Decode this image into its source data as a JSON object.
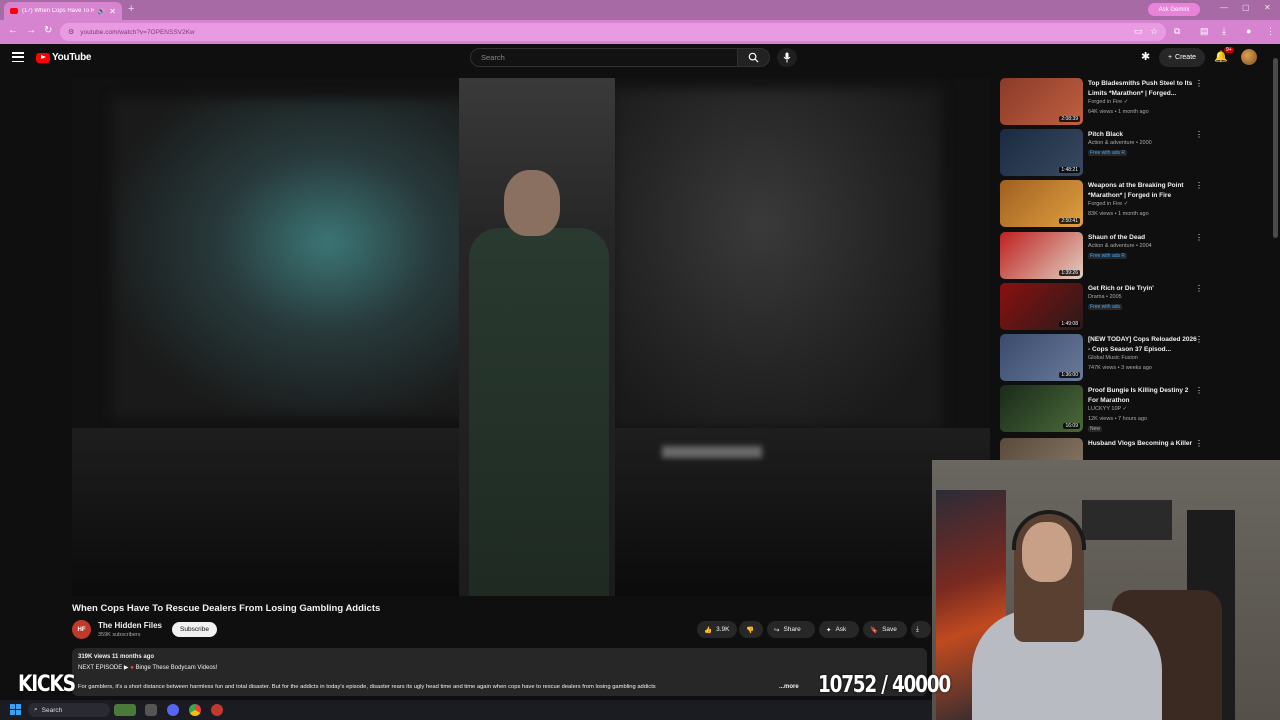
{
  "browser": {
    "tab_title": "(17) When Cops Have To R",
    "new_tab_symbol": "+",
    "ask_gemini": "Ask Gemini",
    "url": "youtube.com/watch?v=7OPENSSV2Kw"
  },
  "youtube": {
    "logo_text": "YouTube",
    "search_placeholder": "Search",
    "create_label": "Create",
    "notif_count": "9+"
  },
  "video": {
    "title": "When Cops Have To Rescue Dealers From Losing Gambling Addicts",
    "channel": {
      "name": "The Hidden Files",
      "subscribers": "359K subscribers",
      "avatar_text": "HF"
    },
    "subscribe_label": "Subscribe",
    "actions": {
      "likes": "3.9K",
      "share": "Share",
      "ask": "Ask",
      "save": "Save"
    },
    "description": {
      "meta": "319K views  11 months ago",
      "next_prefix": "NEXT EPISODE ▶",
      "next_link": "Binge These Bodycam Videos!",
      "body": "For gamblers, it's a short distance between harmless fun and total disaster. But for the addicts in today's episode, disaster rears its ugly head time and time again when cops have to rescue dealers from losing gambling addicts",
      "more": "...more"
    }
  },
  "recommendations": [
    {
      "title": "Top Bladesmiths Push Steel to Its Limits *Marathon* | Forged...",
      "line1": "Forged in Fire ✓",
      "line2": "64K views • 1 month ago",
      "duration": "2:08:39",
      "colors": [
        "#8a3a2a",
        "#c06040"
      ]
    },
    {
      "title": "Pitch Black",
      "line1": "Action & adventure • 2000",
      "line2": "",
      "badge": "Free with ads  R",
      "duration": "1:48:21",
      "colors": [
        "#1a2a40",
        "#3a4a60"
      ]
    },
    {
      "title": "Weapons at the Breaking Point *Marathon* | Forged in Fire",
      "line1": "Forged in Fire ✓",
      "line2": "83K views • 1 month ago",
      "duration": "2:50:41",
      "colors": [
        "#a06020",
        "#e0a040"
      ]
    },
    {
      "title": "Shaun of the Dead",
      "line1": "Action & adventure • 2004",
      "line2": "",
      "badge": "Free with ads  R",
      "duration": "1:39:26",
      "colors": [
        "#c02020",
        "#e0d0c0"
      ]
    },
    {
      "title": "Get Rich or Die Tryin'",
      "line1": "Drama • 2005",
      "line2": "",
      "badge": "Free with ads",
      "duration": "1:49:08",
      "colors": [
        "#8a1010",
        "#2a1a1a"
      ]
    },
    {
      "title": "[NEW TODAY] Cops Reloaded 2026 - Cops Season 37 Episod...",
      "line1": "Global Music Fusion",
      "line2": "747K views • 3 weeks ago",
      "duration": "1:36:00",
      "colors": [
        "#3a4a6a",
        "#6a7a9a"
      ]
    },
    {
      "title": "Proof Bungie Is Killing Destiny 2 For Marathon",
      "line1": "LUCKYY 10P ✓",
      "line2": "12K views • 7 hours ago",
      "badge": "New",
      "duration": "16:09",
      "colors": [
        "#1a2a1a",
        "#4a6a3a"
      ]
    },
    {
      "title": "Husband Vlogs Becoming a Killer",
      "line1": "",
      "line2": "",
      "duration": "",
      "colors": [
        "#5a4a3a",
        "#8a7a6a"
      ]
    }
  ],
  "overlay": {
    "left_text": "KICKS",
    "counter": "10752 / 40000"
  },
  "taskbar": {
    "search_label": "Search"
  }
}
